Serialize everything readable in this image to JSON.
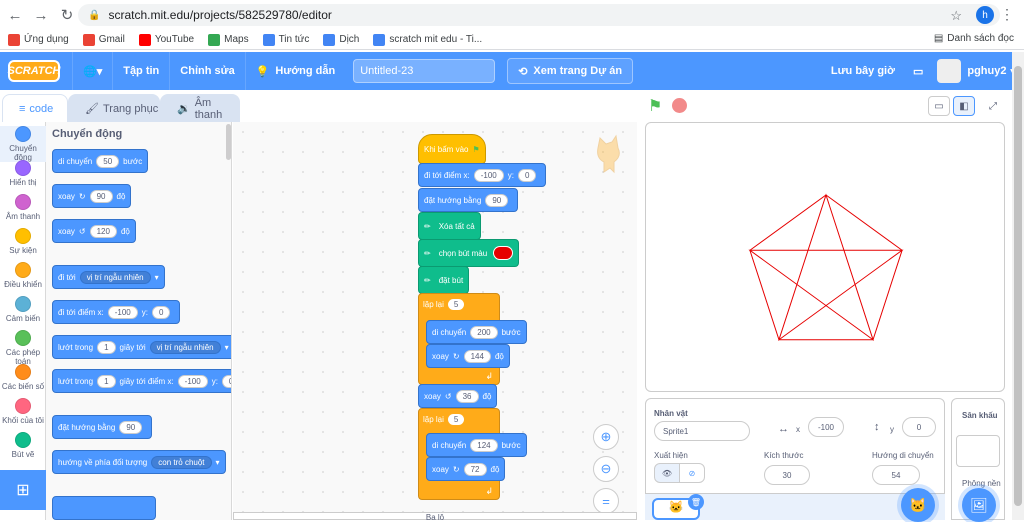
{
  "browser": {
    "url": "scratch.mit.edu/projects/582529780/editor",
    "profile_initial": "h",
    "bookmarks": [
      {
        "label": "Ứng dụng",
        "color": "#ea4335"
      },
      {
        "label": "Gmail",
        "color": "#ea4335"
      },
      {
        "label": "YouTube",
        "color": "#ff0000"
      },
      {
        "label": "Maps",
        "color": "#34a853"
      },
      {
        "label": "Tin tức",
        "color": "#4285f4"
      },
      {
        "label": "Dịch",
        "color": "#4285f4"
      },
      {
        "label": "scratch mit edu - Ti...",
        "color": "#4285f4"
      }
    ],
    "bookmarks_right": "Danh sách đọc"
  },
  "menubar": {
    "logo": "SCRATCH",
    "file": "Tập tin",
    "edit": "Chỉnh sửa",
    "tutorials": "Hướng dẫn",
    "project_title": "Untitled-23",
    "see_project": "Xem trang Dự án",
    "save_now": "Lưu bây giờ",
    "username": "pghuy2"
  },
  "tabs": {
    "code": "code",
    "costumes": "Trang phục",
    "sounds": "Âm thanh"
  },
  "categories": [
    {
      "label": "Chuyển động",
      "color": "#4c97ff"
    },
    {
      "label": "Hiển thị",
      "color": "#9966ff"
    },
    {
      "label": "Âm thanh",
      "color": "#cf63cf"
    },
    {
      "label": "Sự kiện",
      "color": "#ffbf00"
    },
    {
      "label": "Điều khiển",
      "color": "#ffab19"
    },
    {
      "label": "Cảm biến",
      "color": "#5cb1d6"
    },
    {
      "label": "Các phép toán",
      "color": "#59c059"
    },
    {
      "label": "Các biến số",
      "color": "#ff8c1a"
    },
    {
      "label": "Khối của tôi",
      "color": "#ff6680"
    },
    {
      "label": "Bút vẽ",
      "color": "#0fbd8c"
    }
  ],
  "palette": {
    "heading": "Chuyển động",
    "move": {
      "a": "di chuyển",
      "n": "50",
      "b": "bước"
    },
    "turn_right": {
      "a": "xoay",
      "n": "90",
      "b": "độ"
    },
    "turn_left": {
      "a": "xoay",
      "n": "120",
      "b": "độ"
    },
    "goto": {
      "a": "đi tới",
      "d": "vị trí ngẫu nhiên"
    },
    "gotoxy": {
      "a": "đi tới điểm x:",
      "x": "-100",
      "y_label": "y:",
      "y": "0"
    },
    "glide": {
      "a": "lướt trong",
      "n": "1",
      "b": "giây tới",
      "d": "vị trí ngẫu nhiên"
    },
    "glidexy": {
      "a": "lướt trong",
      "n": "1",
      "b": "giây tới điểm x:",
      "x": "-100",
      "y_label": "y:",
      "y": "0"
    },
    "point": {
      "a": "đặt hướng bằng",
      "n": "90"
    },
    "pointto": {
      "a": "hướng về phía đối tượng",
      "d": "con trỏ chuột"
    }
  },
  "script": {
    "hat": "Khi bấm vào",
    "gotoxy": {
      "a": "đi tới điểm x:",
      "x": "-100",
      "y_label": "y:",
      "y": "0"
    },
    "point": {
      "a": "đặt hướng bằng",
      "n": "90"
    },
    "clear": "Xóa tất cả",
    "color": "chọn bút màu",
    "pen_color": "#e60000",
    "pendown": "đặt bút",
    "repeat1": {
      "a": "lặp lại",
      "n": "5"
    },
    "move1": {
      "a": "di chuyển",
      "n": "200",
      "b": "bước"
    },
    "turn1": {
      "a": "xoay",
      "n": "144",
      "b": "độ"
    },
    "turn_mid": {
      "a": "xoay",
      "n": "36",
      "b": "độ"
    },
    "repeat2": {
      "a": "lặp lại",
      "n": "5"
    },
    "move2": {
      "a": "di chuyển",
      "n": "124",
      "b": "bước"
    },
    "turn2": {
      "a": "xoay",
      "n": "72",
      "b": "độ"
    }
  },
  "sprite_info": {
    "sprite_label": "Nhân vật",
    "sprite_name": "Sprite1",
    "x_label": "x",
    "x": "-100",
    "y_label": "y",
    "y": "0",
    "show_label": "Xuất hiện",
    "size_label": "Kích thước",
    "size": "30",
    "direction_label": "Hướng di chuyển",
    "direction": "54"
  },
  "stage_panel": {
    "label": "Sân khấu",
    "backdrops": "Phông nền"
  },
  "stage_drawing_color": "#e60000",
  "bottom_tab": "Ba lô"
}
